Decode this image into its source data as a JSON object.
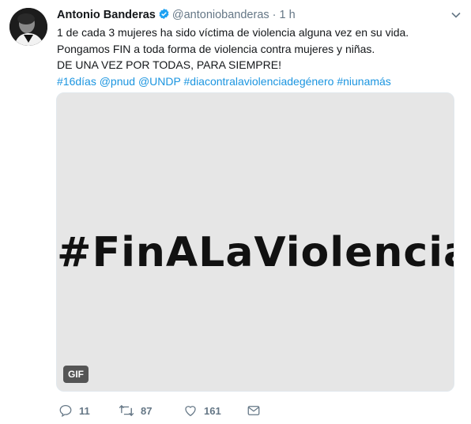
{
  "author": {
    "name": "Antonio Banderas",
    "handle": "@antoniobanderas",
    "separator": "·",
    "time": "1 h"
  },
  "tweet_lines": [
    "1 de cada 3 mujeres ha sido víctima de violencia alguna vez en su vida.",
    "Pongamos FIN a toda forma de violencia contra mujeres y niñas.",
    "DE UNA VEZ POR TODAS, PARA SIEMPRE!"
  ],
  "hashtags": [
    "#16días",
    "@pnud",
    "@UNDP",
    "#diacontralaviolenciadegénero",
    "#niunamás"
  ],
  "media": {
    "text": "#FinALaViolencia",
    "badge": "GIF",
    "background": "#e6e6e6"
  },
  "actions": {
    "reply_count": "11",
    "retweet_count": "87",
    "like_count": "161"
  },
  "colors": {
    "link": "#1b95e0",
    "muted": "#657786",
    "verified": "#1da1f2"
  },
  "icons": [
    "verified-badge-icon",
    "chevron-down-icon",
    "reply-icon",
    "retweet-icon",
    "like-icon",
    "direct-message-icon"
  ]
}
